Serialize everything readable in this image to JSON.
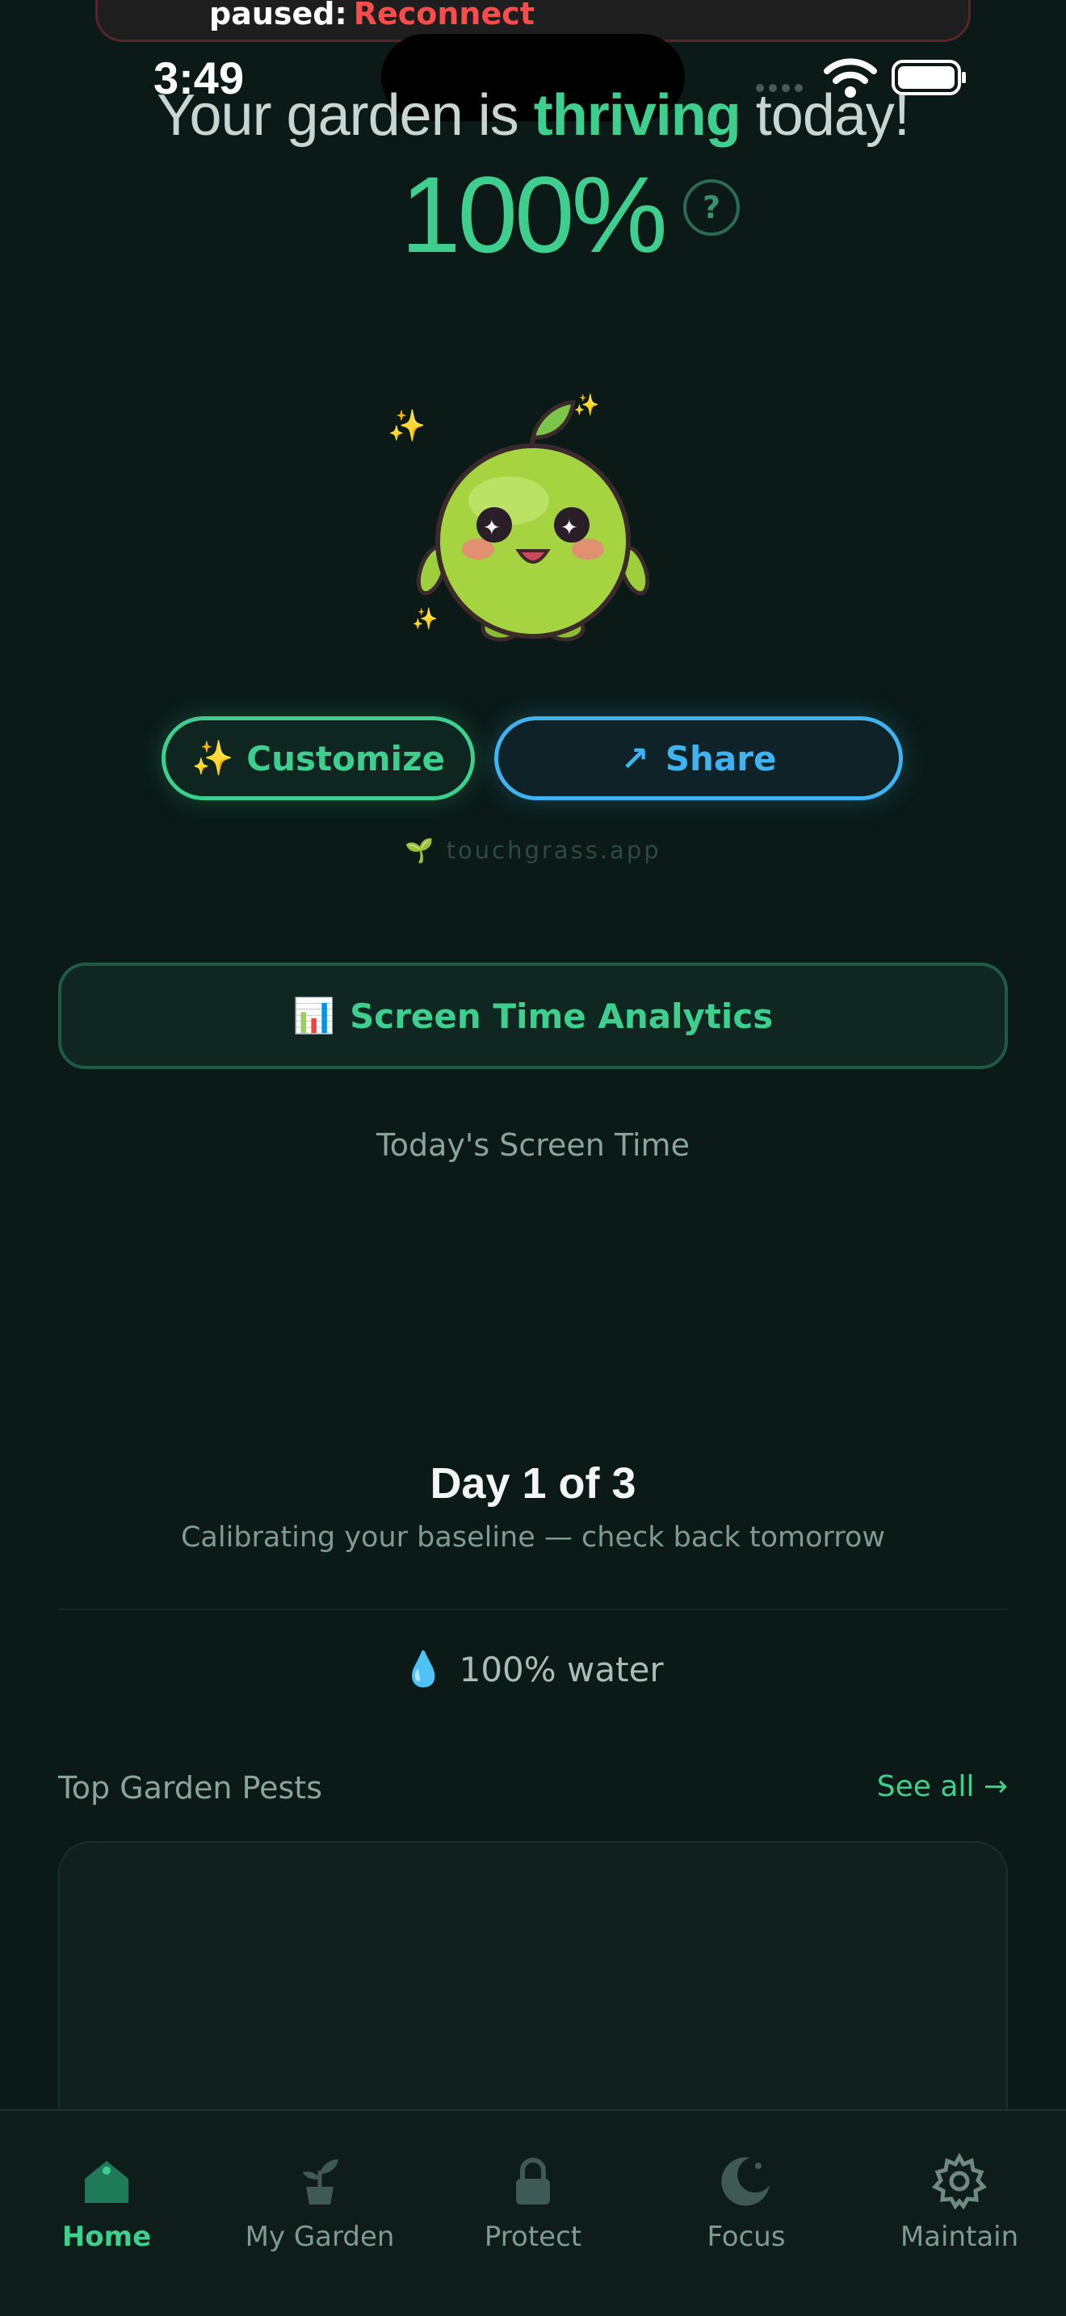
{
  "banner": {
    "text": "paused:",
    "action": "Reconnect"
  },
  "status_bar": {
    "time": "3:49"
  },
  "header": {
    "headline_pre": "Your garden is ",
    "headline_accent": "thriving",
    "headline_post": " today!",
    "percent": "100%",
    "help": "?"
  },
  "actions": {
    "customize_icon": "✨",
    "customize": "Customize",
    "share_icon": "↗",
    "share": "Share"
  },
  "watermark": {
    "icon": "🌱",
    "text": "touchgrass.app"
  },
  "analytics": {
    "icon": "📊",
    "label": "Screen Time Analytics"
  },
  "screen_time": {
    "label": "Today's Screen Time"
  },
  "calibration": {
    "title": "Day 1 of 3",
    "subtitle": "Calibrating your baseline — check back tomorrow"
  },
  "water": {
    "icon": "💧",
    "text": "100% water"
  },
  "pests": {
    "title": "Top Garden Pests",
    "see_all": "See all →"
  },
  "tabs": [
    {
      "label": "Home",
      "icon": "home-icon",
      "active": true
    },
    {
      "label": "My Garden",
      "icon": "sprout-icon",
      "active": false
    },
    {
      "label": "Protect",
      "icon": "lock-icon",
      "active": false
    },
    {
      "label": "Focus",
      "icon": "moon-icon",
      "active": false
    },
    {
      "label": "Maintain",
      "icon": "gear-icon",
      "active": false
    }
  ],
  "colors": {
    "accent": "#3ecf8e",
    "share": "#3fb3f0",
    "background": "#0b1a17",
    "alert": "#ff4b4b"
  }
}
